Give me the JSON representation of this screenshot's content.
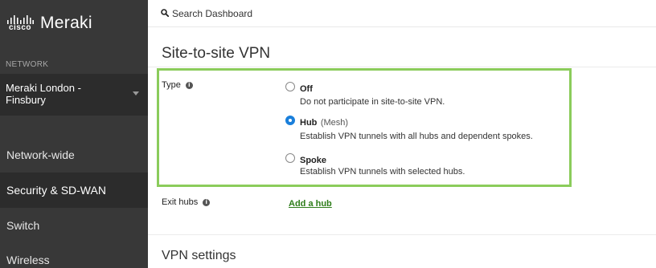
{
  "brand": {
    "cisco_word": "cisco",
    "product": "Meraki"
  },
  "sidebar": {
    "heading": "NETWORK",
    "network_name": "Meraki London - Finsbury",
    "items": [
      {
        "label": "Network-wide"
      },
      {
        "label": "Security & SD-WAN"
      },
      {
        "label": "Switch"
      },
      {
        "label": "Wireless"
      }
    ]
  },
  "search": {
    "placeholder": "Search Dashboard"
  },
  "page": {
    "title": "Site-to-site VPN",
    "type_label": "Type",
    "options": [
      {
        "label": "Off",
        "sub": "",
        "desc": "Do not participate in site-to-site VPN.",
        "selected": false
      },
      {
        "label": "Hub",
        "sub": "(Mesh)",
        "desc": "Establish VPN tunnels with all hubs and dependent spokes.",
        "selected": true
      },
      {
        "label": "Spoke",
        "sub": "",
        "desc": "Establish VPN tunnels with selected hubs.",
        "selected": false
      }
    ],
    "exit_hubs_label": "Exit hubs",
    "add_hub_link": "Add a hub",
    "vpn_settings_title": "VPN settings"
  },
  "colors": {
    "sidebar_bg": "#383838",
    "sidebar_active": "#2c2c2c",
    "highlight": "#8bcc5b",
    "radio_selected": "#1a7fdb",
    "link": "#2e7d1a"
  },
  "icons": [
    "cisco-logo-icon",
    "search-icon",
    "chevron-down-icon",
    "info-icon"
  ]
}
